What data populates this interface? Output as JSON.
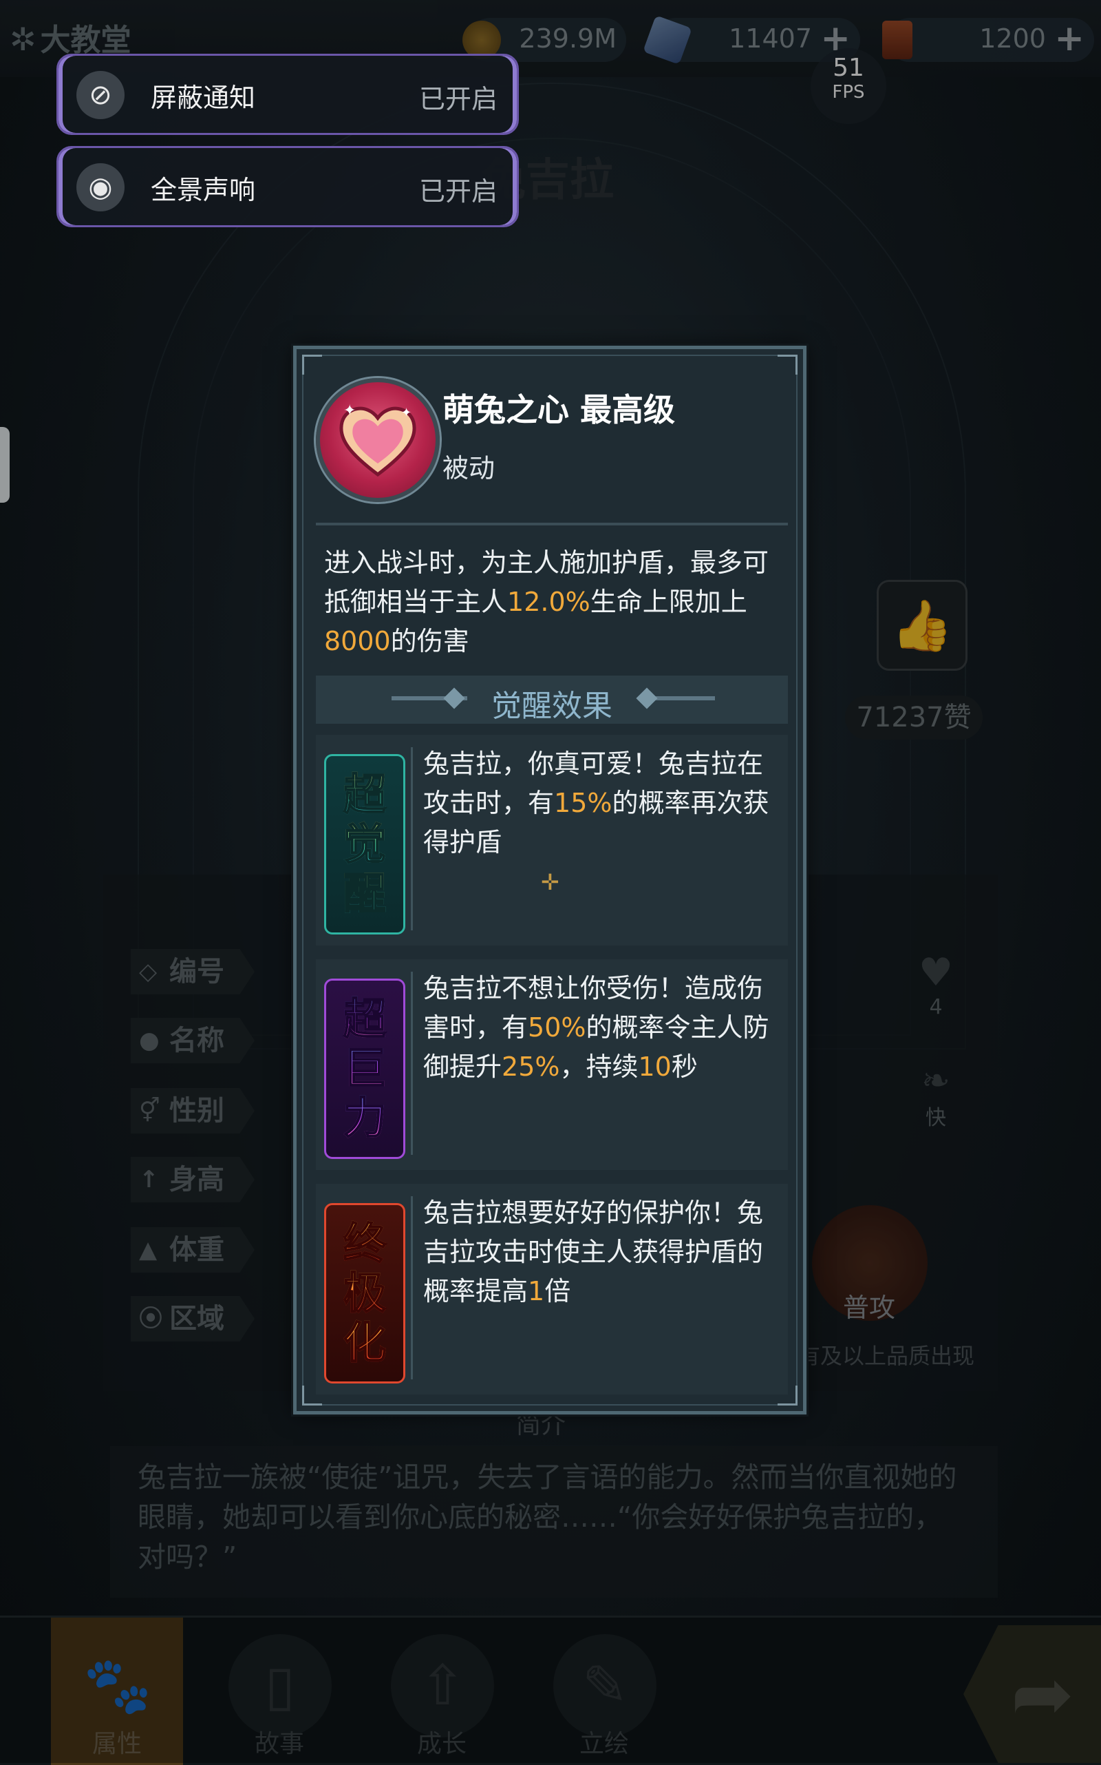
{
  "topbar": {
    "location": "大教堂",
    "currencies": [
      {
        "icon": "gold-coin-icon",
        "value": "239.9M"
      },
      {
        "icon": "crystal-icon",
        "value": "11407",
        "plus": "+"
      },
      {
        "icon": "ticket-icon",
        "value": "1200",
        "plus": "+"
      }
    ]
  },
  "fps": {
    "value": "51",
    "unit": "FPS"
  },
  "toasts": [
    {
      "title": "屏蔽通知",
      "status": "已开启",
      "icon": "notification-off-icon"
    },
    {
      "title": "全景声响",
      "status": "已开启",
      "icon": "speaker-icon"
    }
  ],
  "character": {
    "name": "兔吉拉",
    "likes": "71237赞"
  },
  "profile_rows": [
    "编号",
    "名称",
    "性别",
    "身高",
    "体重",
    "区域"
  ],
  "stats": {
    "hearts": "4",
    "speed": "快"
  },
  "attack_label": "普攻",
  "quality_note": "有及以上品质出现",
  "intro": {
    "title": "简介",
    "text": "兔吉拉一族被“使徒”诅咒，失去了言语的能力。然而当你直视她的眼睛，她却可以看到你心底的秘密……“你会好好保护兔吉拉的，对吗？”"
  },
  "bottom_nav": {
    "tabs": [
      {
        "label": "属性",
        "icon": "paw-icon",
        "active": true
      },
      {
        "label": "故事",
        "icon": "book-icon"
      },
      {
        "label": "成长",
        "icon": "arrow-up-icon"
      },
      {
        "label": "立绘",
        "icon": "paint-brush-icon"
      }
    ],
    "next": "arrow-right-icon"
  },
  "skill": {
    "name": "萌兔之心 最高级",
    "type": "被动",
    "desc_parts": [
      "进入战斗时，为主人施加护盾，最多可抵御相当于主人",
      "12.0%",
      "生命上限加上",
      "8000",
      "的伤害"
    ],
    "awaken_title": "觉醒效果",
    "awakenings": [
      {
        "badge": [
          "超",
          "觉",
          "醒"
        ],
        "parts": [
          "兔吉拉，你真可爱！兔吉拉在攻击时，有",
          "15%",
          "的概率再次获得护盾"
        ]
      },
      {
        "badge": [
          "超",
          "巨",
          "力"
        ],
        "parts": [
          "兔吉拉不想让你受伤！造成伤害时，有",
          "50%",
          "的概率令主人防御提升",
          "25%",
          "，持续",
          "10",
          "秒"
        ]
      },
      {
        "badge": [
          "终",
          "极",
          "化"
        ],
        "parts": [
          "兔吉拉想要好好的保护你！兔吉拉攻击时使主人获得护盾的概率提高",
          "1",
          "倍"
        ]
      }
    ]
  },
  "colors": {
    "highlight": "#f1a93b",
    "awaken_title": "#8fb6cc",
    "toast_border": "#6a56a8"
  }
}
